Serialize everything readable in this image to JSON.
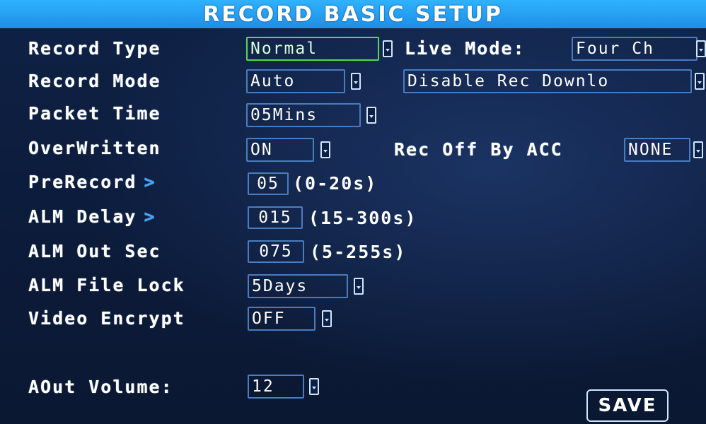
{
  "title": "RECORD BASIC SETUP",
  "rows": {
    "record_type": {
      "label": "Record Type",
      "value": "Normal"
    },
    "live_mode": {
      "label": "Live Mode:",
      "value": "Four Ch"
    },
    "record_mode": {
      "label": "Record Mode",
      "value": "Auto"
    },
    "rec_download": {
      "value": "Disable Rec Downlo"
    },
    "packet_time": {
      "label": "Packet Time",
      "value": "05Mins"
    },
    "overwritten": {
      "label": "OverWritten",
      "value": "ON"
    },
    "rec_off_by_acc": {
      "label": "Rec Off By ACC",
      "value": "NONE"
    },
    "prerecord": {
      "label": "PreRecord",
      "chevron": ">",
      "value": "05",
      "range": "(0-20s)"
    },
    "alm_delay": {
      "label": "ALM Delay",
      "chevron": ">",
      "value": "015",
      "range": "(15-300s)"
    },
    "alm_out_sec": {
      "label": "ALM Out Sec",
      "value": "075",
      "range": "(5-255s)"
    },
    "alm_file_lock": {
      "label": "ALM File Lock",
      "value": "5Days"
    },
    "video_encrypt": {
      "label": "Video Encrypt",
      "value": "OFF"
    },
    "aout_volume": {
      "label": "AOut Volume:",
      "value": "12"
    }
  },
  "save_label": "SAVE",
  "colors": {
    "title_bar": "#1e8ee6",
    "focus_border": "#49e04a",
    "field_border": "#4a7cc0",
    "chevron": "#3aa6ff"
  }
}
